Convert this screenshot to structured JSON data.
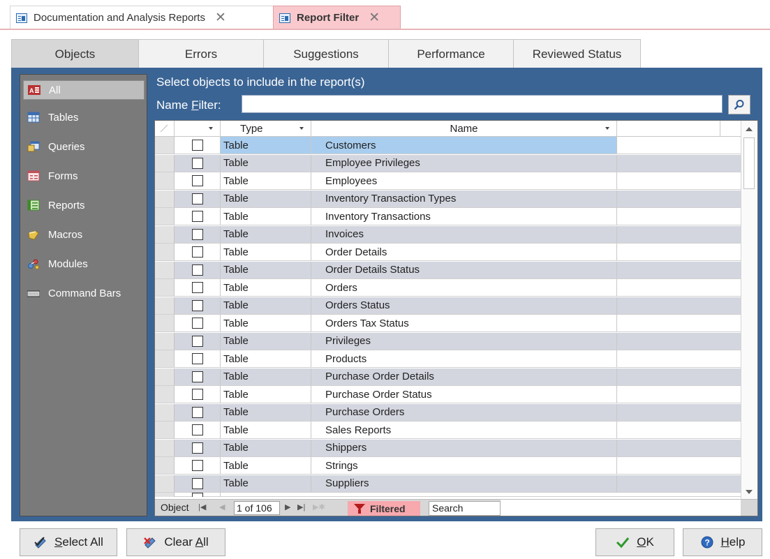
{
  "doc_tabs": [
    {
      "label": "Documentation and Analysis Reports",
      "active": false
    },
    {
      "label": "Report Filter",
      "active": true
    }
  ],
  "section_tabs": [
    "Objects",
    "Errors",
    "Suggestions",
    "Performance",
    "Reviewed Status"
  ],
  "sidebar": {
    "items": [
      {
        "label": "All",
        "icon": "access-all-icon",
        "active": true
      },
      {
        "label": "Tables",
        "icon": "table-icon"
      },
      {
        "label": "Queries",
        "icon": "query-icon"
      },
      {
        "label": "Forms",
        "icon": "form-icon"
      },
      {
        "label": "Reports",
        "icon": "report-icon"
      },
      {
        "label": "Macros",
        "icon": "macro-icon"
      },
      {
        "label": "Modules",
        "icon": "module-icon"
      },
      {
        "label": "Command Bars",
        "icon": "command-bar-icon"
      }
    ]
  },
  "main": {
    "prompt": "Select objects to include in the report(s)",
    "filter_label_pre": "Name ",
    "filter_label_accel": "F",
    "filter_label_post": "ilter:",
    "filter_value": ""
  },
  "grid": {
    "columns": [
      "",
      "Type",
      "Name"
    ],
    "rows": [
      {
        "checked": false,
        "type": "Table",
        "name": "Customers",
        "selected": true
      },
      {
        "checked": false,
        "type": "Table",
        "name": "Employee Privileges"
      },
      {
        "checked": false,
        "type": "Table",
        "name": "Employees"
      },
      {
        "checked": false,
        "type": "Table",
        "name": "Inventory Transaction Types"
      },
      {
        "checked": false,
        "type": "Table",
        "name": "Inventory Transactions"
      },
      {
        "checked": false,
        "type": "Table",
        "name": "Invoices"
      },
      {
        "checked": false,
        "type": "Table",
        "name": "Order Details"
      },
      {
        "checked": false,
        "type": "Table",
        "name": "Order Details Status"
      },
      {
        "checked": false,
        "type": "Table",
        "name": "Orders"
      },
      {
        "checked": false,
        "type": "Table",
        "name": "Orders Status"
      },
      {
        "checked": false,
        "type": "Table",
        "name": "Orders Tax Status"
      },
      {
        "checked": false,
        "type": "Table",
        "name": "Privileges"
      },
      {
        "checked": false,
        "type": "Table",
        "name": "Products"
      },
      {
        "checked": false,
        "type": "Table",
        "name": "Purchase Order Details"
      },
      {
        "checked": false,
        "type": "Table",
        "name": "Purchase Order Status"
      },
      {
        "checked": false,
        "type": "Table",
        "name": "Purchase Orders"
      },
      {
        "checked": false,
        "type": "Table",
        "name": "Sales Reports"
      },
      {
        "checked": false,
        "type": "Table",
        "name": "Shippers"
      },
      {
        "checked": false,
        "type": "Table",
        "name": "Strings"
      },
      {
        "checked": false,
        "type": "Table",
        "name": "Suppliers"
      }
    ]
  },
  "record_nav": {
    "label": "Object",
    "position": "1 of 106",
    "filtered": "Filtered",
    "search": "Search"
  },
  "buttons": {
    "select_all_pre": "",
    "select_all_accel": "S",
    "select_all_post": "elect All",
    "clear_all_pre": "Clear ",
    "clear_all_accel": "A",
    "clear_all_post": "ll",
    "ok_pre": "",
    "ok_accel": "O",
    "ok_post": "K",
    "help_pre": "",
    "help_accel": "H",
    "help_post": "elp"
  },
  "colors": {
    "panel": "#3a6494",
    "sidebar": "#7a7a7a",
    "active_doc_tab": "#f9c9cd",
    "alt_row": "#d3d6df",
    "selected_cell": "#a9cdee",
    "filtered_badge": "#f7a9ae"
  }
}
